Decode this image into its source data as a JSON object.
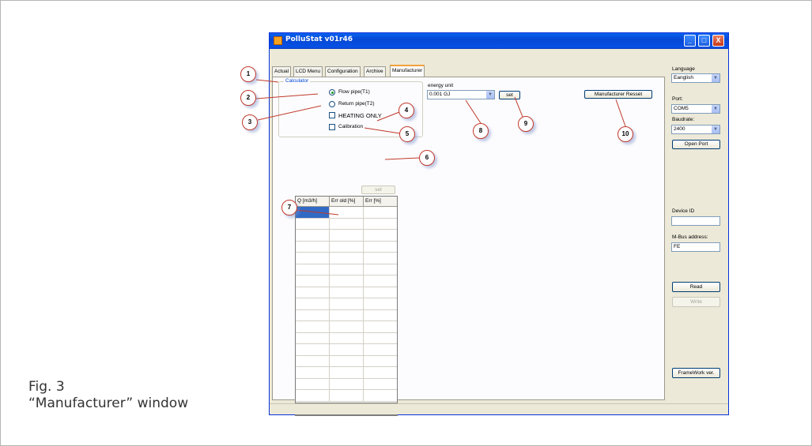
{
  "figure": {
    "caption_line1": "Fig. 3",
    "caption_line2": "“Manufacturer” window"
  },
  "window": {
    "title": "PolluStat v01r46",
    "minimize_glyph": "_",
    "maximize_glyph": "□",
    "close_glyph": "X"
  },
  "tabs": [
    "Actual",
    "LCD Menu",
    "Configuration",
    "Archive",
    "Manufacturer"
  ],
  "active_tab": "Manufacturer",
  "calculator": {
    "legend": "Calculator",
    "flow_pipe_label": "Flow pipe(T1)",
    "flow_pipe_checked": true,
    "return_pipe_label": "Return pipe(T2)",
    "return_pipe_checked": false,
    "heating_only_label": "HEATING ONLY",
    "heating_only_checked": false,
    "calibration_label": "Calibration",
    "calibration_checked": false
  },
  "energy": {
    "label": "energy unit",
    "value": "0.001 GJ",
    "set_label": "set"
  },
  "manufacturer_reset_label": "Manufacturer Resset",
  "calibration_table": {
    "set_label": "set",
    "columns": [
      "Q [m3/h]",
      "Err old [%]",
      "Err [%]"
    ],
    "row_count": 17
  },
  "right_panel": {
    "language_label": "Language",
    "language_value": "Eanglish",
    "port_label": "Port:",
    "port_value": "COM5",
    "baudrate_label": "Baudrate:",
    "baudrate_value": "2400",
    "open_port_label": "Open Port",
    "device_id_label": "Device ID",
    "device_id_value": "",
    "mbus_label": "M-Bus address:",
    "mbus_value": "FE",
    "read_label": "Read",
    "write_label": "Write",
    "framework_label": "FrameWork ver."
  },
  "callouts": [
    "1",
    "2",
    "3",
    "4",
    "5",
    "6",
    "7",
    "8",
    "9",
    "10"
  ],
  "colors": {
    "titlebar": "#0548d4",
    "window_bg": "#ece9d8",
    "callout_border": "#c0392b",
    "selected_cell": "#316ac5"
  },
  "icons": {
    "dropdown": "chevron-down-icon",
    "radio_selected": "radio-on-icon",
    "app": "app-icon"
  }
}
